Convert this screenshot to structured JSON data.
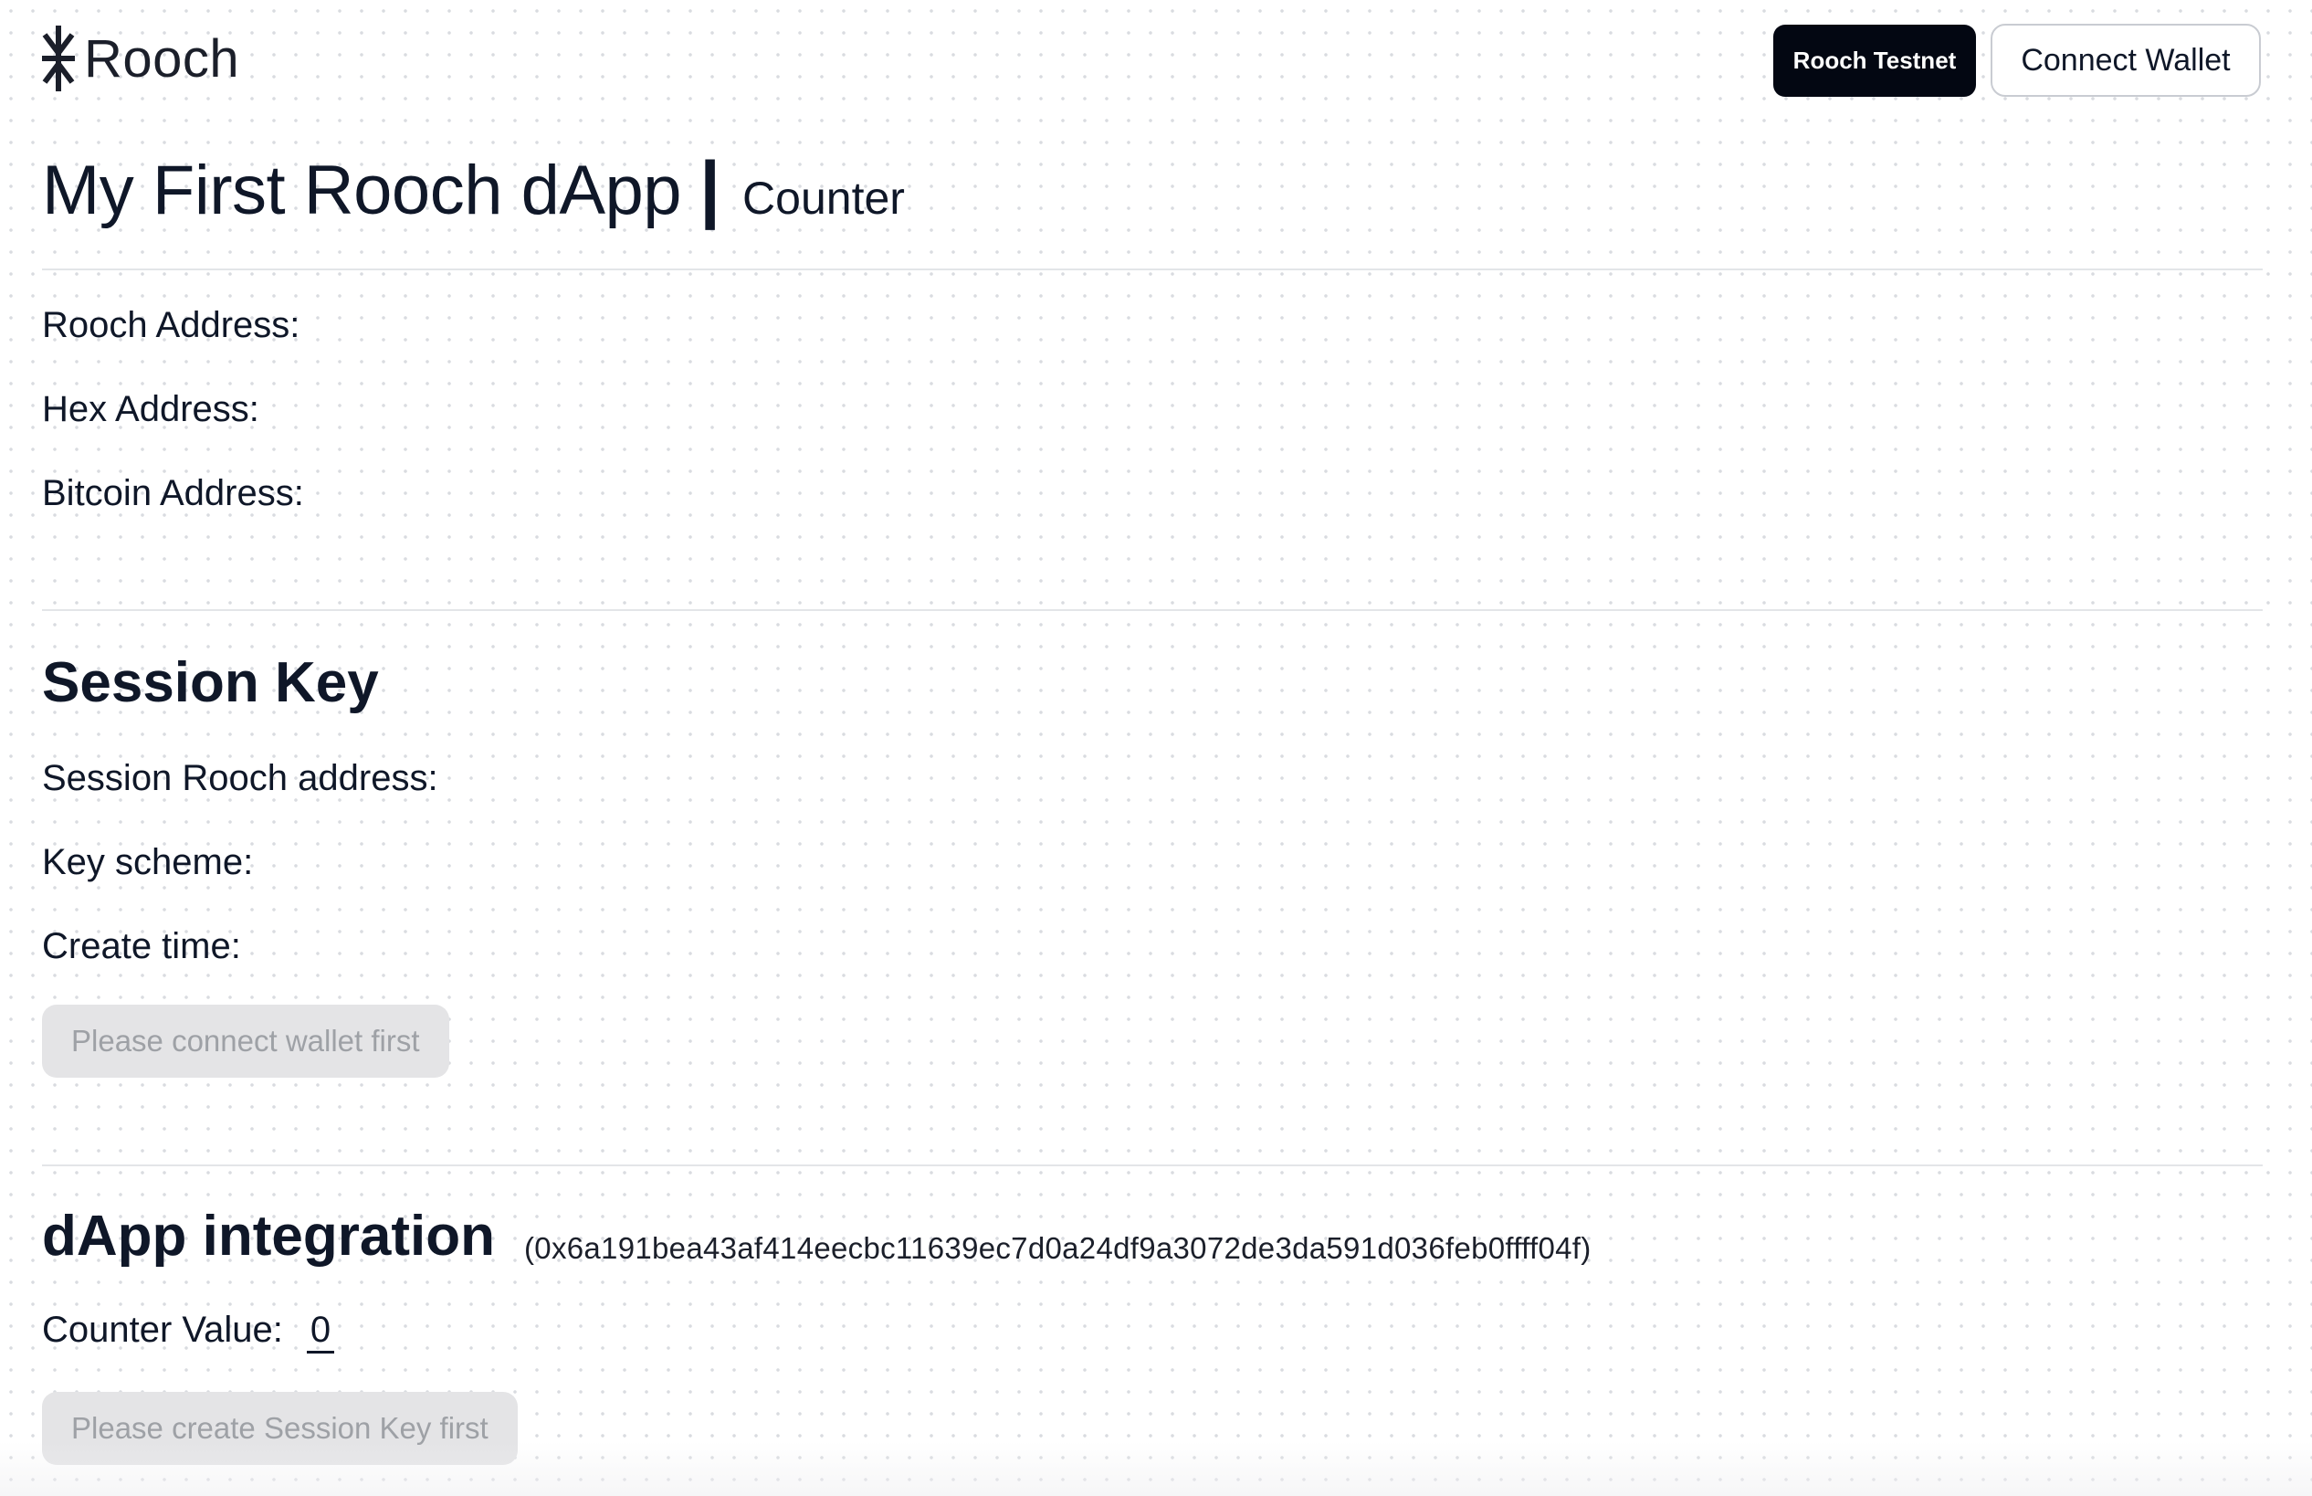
{
  "header": {
    "logo_text": "Rooch",
    "logo_icon": "rooch-asterisk-icon",
    "network_label": "Rooch Testnet",
    "connect_label": "Connect Wallet"
  },
  "title": {
    "main": "My First Rooch dApp",
    "separator": "|",
    "subtitle": "Counter"
  },
  "account": {
    "rooch_address_label": "Rooch Address:",
    "hex_address_label": "Hex Address:",
    "bitcoin_address_label": "Bitcoin Address:"
  },
  "session": {
    "heading": "Session Key",
    "rooch_address_label": "Session Rooch address:",
    "key_scheme_label": "Key scheme:",
    "create_time_label": "Create time:",
    "button_label": "Please connect wallet first"
  },
  "dapp": {
    "heading": "dApp integration",
    "contract_address": "(0x6a191bea43af414eecbc11639ec7d0a24df9a3072de3da591d036feb0ffff04f)",
    "counter_label": "Counter Value:",
    "counter_value": "0",
    "button_label": "Please create Session Key first"
  },
  "colors": {
    "primary_dark": "#030712",
    "text": "#0f1728",
    "disabled_bg": "#e4e4e6",
    "disabled_text": "#9ea1a6",
    "divider": "#e3e5e8"
  }
}
